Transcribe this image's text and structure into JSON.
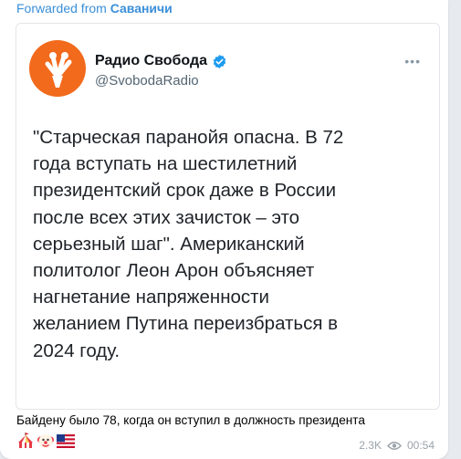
{
  "forward": {
    "prefix": "Forwarded from",
    "source": "Саваничи"
  },
  "tweet_card": {
    "account_name": "Радио Свобода",
    "handle": "@SvobodaRadio",
    "more_icon": "more-horizontal-icon",
    "verified_icon": "verified-badge-icon",
    "logo_color": "#f26a1c",
    "lines": [
      "\"Старческая паранойя опасна. В 72",
      "года вступать на шестилетний",
      "президентский срок даже в России",
      "после всех этих зачисток – это",
      "серьезный шаг\". Американский",
      "политолог Леон Арон объясняет",
      "нагнетание напряженности",
      "желанием Путина переизбраться в",
      "2024 году."
    ]
  },
  "message": {
    "caption": "Байдену было 78, когда он вступил в должность президента",
    "emojis": [
      "circus-tent-emoji",
      "clown-face-emoji",
      "us-flag-emoji"
    ],
    "views": "2.3K",
    "time": "00:54",
    "accent_color": "#3a8fd9"
  }
}
